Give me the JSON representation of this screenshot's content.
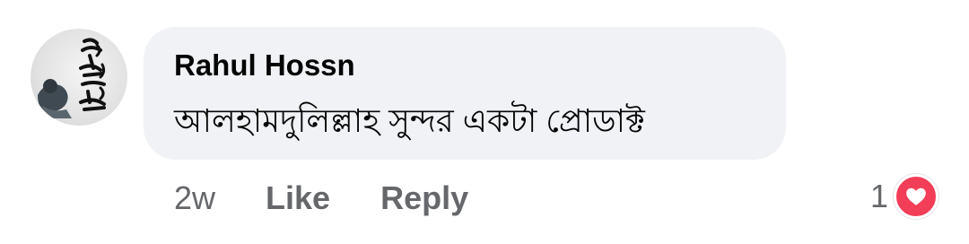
{
  "comment": {
    "author": "Rahul Hossn",
    "text": "আলহামদুলিল্লাহ সুন্দর একটা প্রোডাক্ট",
    "time": "2w",
    "like_label": "Like",
    "reply_label": "Reply",
    "reaction_count": "1",
    "reaction_icon": "heart-icon"
  },
  "colors": {
    "bubble_bg": "#f0f2f5",
    "author_text": "#050505",
    "secondary_text": "#65676b",
    "reaction_heart": "#f33e58"
  }
}
